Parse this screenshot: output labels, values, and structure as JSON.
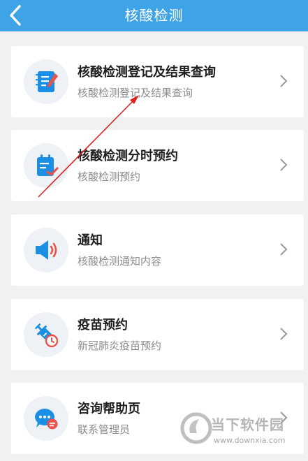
{
  "header": {
    "title": "核酸检测",
    "back_icon": "chevron-left-icon"
  },
  "colors": {
    "header_bg": "#3fa3e8",
    "icon_blue": "#1a8fe3",
    "icon_red": "#e8534a",
    "annotation_red": "#e0201c"
  },
  "items": [
    {
      "title": "核酸检测登记及结果查询",
      "subtitle": "核酸检测登记及结果查询",
      "icon": "notebook-edit-icon"
    },
    {
      "title": "核酸检测分时预约",
      "subtitle": "核酸检测预约",
      "icon": "calendar-check-icon"
    },
    {
      "title": "通知",
      "subtitle": "核酸检测通知内容",
      "icon": "speaker-icon"
    },
    {
      "title": "疫苗预约",
      "subtitle": "新冠肺炎疫苗预约",
      "icon": "syringe-clock-icon"
    },
    {
      "title": "咨询帮助页",
      "subtitle": "联系管理员",
      "icon": "chat-bubble-icon"
    }
  ],
  "watermark": {
    "name": "当下软件园",
    "url": "www.downxia.com"
  }
}
